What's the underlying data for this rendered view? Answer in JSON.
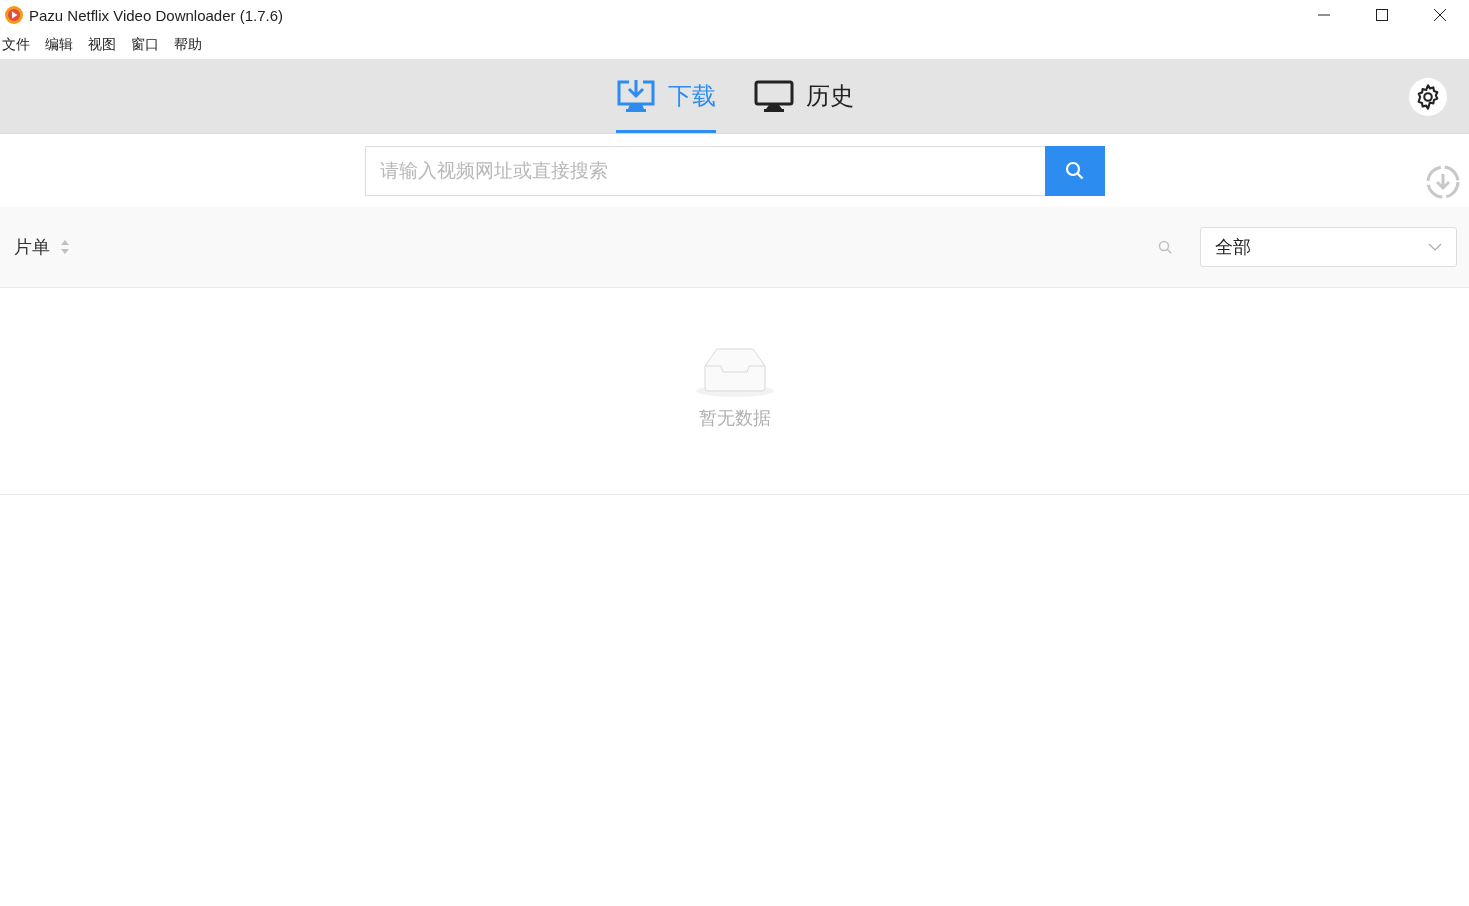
{
  "window": {
    "title": "Pazu Netflix Video Downloader (1.7.6)"
  },
  "menu": [
    "文件",
    "编辑",
    "视图",
    "窗口",
    "帮助"
  ],
  "tabs": [
    {
      "label": "下载",
      "kind": "download",
      "selected": true
    },
    {
      "label": "历史",
      "kind": "monitor",
      "selected": false
    }
  ],
  "search": {
    "placeholder": "请输入视频网址或直接搜索"
  },
  "list": {
    "column": "片单",
    "filter": "全部",
    "empty": "暂无数据"
  }
}
